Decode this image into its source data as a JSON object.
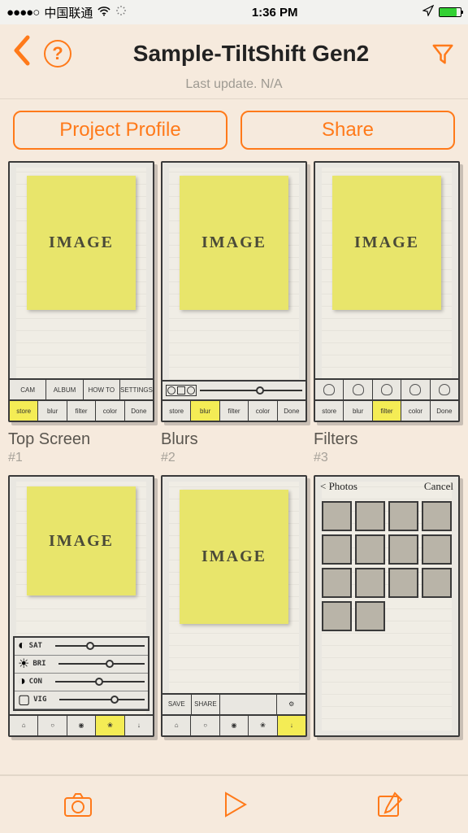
{
  "status": {
    "carrier": "中国联通",
    "time": "1:36 PM"
  },
  "header": {
    "title": "Sample-TiltShift Gen2",
    "subtitle": "Last update. N/A",
    "help": "?"
  },
  "actions": {
    "profile": "Project Profile",
    "share": "Share"
  },
  "cards": [
    {
      "title": "Top Screen",
      "index": "#1",
      "sticky": "IMAGE"
    },
    {
      "title": "Blurs",
      "index": "#2",
      "sticky": "IMAGE"
    },
    {
      "title": "Filters",
      "index": "#3",
      "sticky": "IMAGE"
    },
    {
      "title": "",
      "index": "",
      "sticky": "IMAGE"
    },
    {
      "title": "",
      "index": "",
      "sticky": "IMAGE"
    },
    {
      "title": "",
      "index": "",
      "sticky": ""
    }
  ],
  "photos_thumb": {
    "back": "< Photos",
    "cancel": "Cancel"
  },
  "sketch_toolbar": {
    "row1_a": [
      "CAM",
      "ALBUM",
      "HOW TO",
      "",
      "SETTINGS"
    ],
    "row2": [
      "store",
      "blur",
      "filter",
      "color",
      "Done"
    ]
  },
  "sliders": [
    "SAT",
    "BRI",
    "CON",
    "VIG"
  ]
}
